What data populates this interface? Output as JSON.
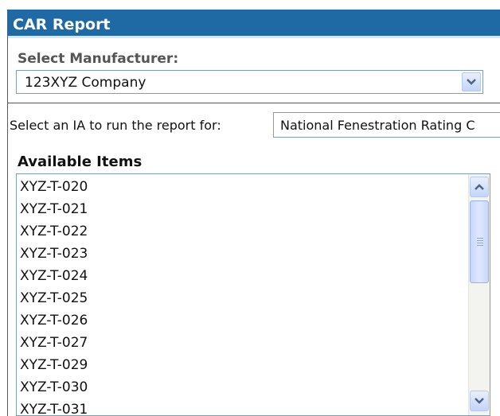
{
  "panel": {
    "title": "CAR Report"
  },
  "manufacturer": {
    "label": "Select Manufacturer:",
    "selected": "123XYZ Company"
  },
  "ia": {
    "label": "Select an IA to run the report for:",
    "selected": "National Fenestration Rating C"
  },
  "available_items": {
    "title": "Available Items",
    "items": [
      "XYZ-T-020",
      "XYZ-T-021",
      "XYZ-T-022",
      "XYZ-T-023",
      "XYZ-T-024",
      "XYZ-T-025",
      "XYZ-T-026",
      "XYZ-T-027",
      "XYZ-T-029",
      "XYZ-T-030",
      "XYZ-T-031"
    ]
  },
  "colors": {
    "header": "#1f6aa5",
    "border": "#7f9db9"
  },
  "icons": {
    "dropdown": "chevron-down-icon",
    "scroll_up": "chevron-up-icon",
    "scroll_down": "chevron-down-icon"
  }
}
